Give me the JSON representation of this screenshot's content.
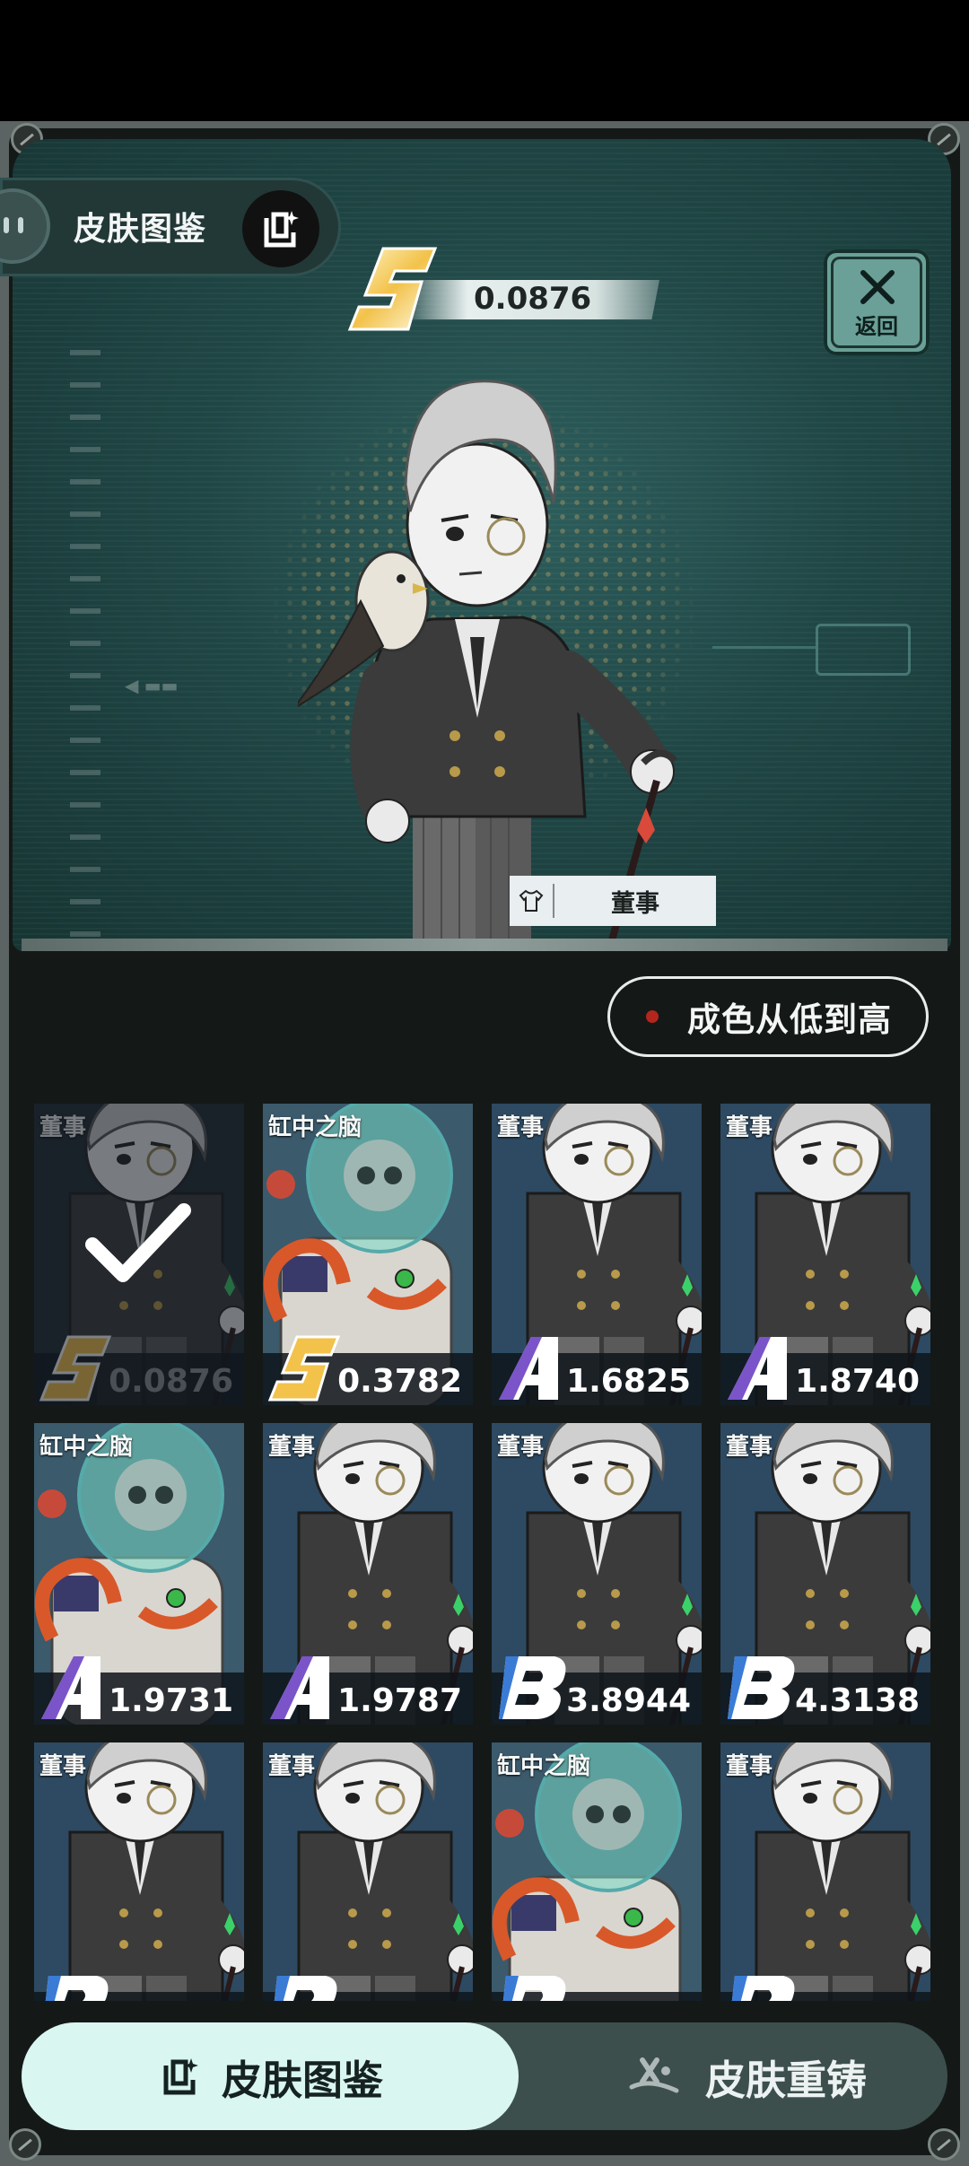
{
  "header": {
    "title": "皮肤图鉴"
  },
  "showcase": {
    "rarity_grade": "S",
    "rarity_value": "0.0876",
    "skin_name": "董事",
    "back_label": "返回"
  },
  "sort": {
    "label": "成色从低到高"
  },
  "cards": [
    {
      "name": "董事",
      "grade": "S",
      "value": "0.0876",
      "selected": true,
      "art": "director"
    },
    {
      "name": "缸中之脑",
      "grade": "S",
      "value": "0.3782",
      "selected": false,
      "art": "brain"
    },
    {
      "name": "董事",
      "grade": "A",
      "value": "1.6825",
      "selected": false,
      "art": "director"
    },
    {
      "name": "董事",
      "grade": "A",
      "value": "1.8740",
      "selected": false,
      "art": "director"
    },
    {
      "name": "缸中之脑",
      "grade": "A",
      "value": "1.9731",
      "selected": false,
      "art": "brain"
    },
    {
      "name": "董事",
      "grade": "A",
      "value": "1.9787",
      "selected": false,
      "art": "director"
    },
    {
      "name": "董事",
      "grade": "B",
      "value": "3.8944",
      "selected": false,
      "art": "director"
    },
    {
      "name": "董事",
      "grade": "B",
      "value": "4.3138",
      "selected": false,
      "art": "director"
    },
    {
      "name": "董事",
      "grade": "B",
      "value": "",
      "selected": false,
      "art": "director"
    },
    {
      "name": "董事",
      "grade": "B",
      "value": "",
      "selected": false,
      "art": "director"
    },
    {
      "name": "缸中之脑",
      "grade": "B",
      "value": "",
      "selected": false,
      "art": "brain"
    },
    {
      "name": "董事",
      "grade": "B",
      "value": "",
      "selected": false,
      "art": "director"
    }
  ],
  "tabs": [
    {
      "label": "皮肤图鉴",
      "active": true,
      "icon": "skin-collection-icon"
    },
    {
      "label": "皮肤重铸",
      "active": false,
      "icon": "recast-icon"
    }
  ],
  "colors": {
    "grade_S": "#f2c24a",
    "grade_A": "#7b54c9",
    "grade_B": "#3a7bd5",
    "active_tab": "#d9f6f1"
  }
}
